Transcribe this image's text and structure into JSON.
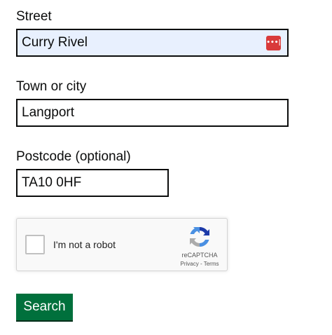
{
  "form": {
    "street": {
      "label": "Street",
      "value": "Curry Rivel",
      "autofilled": true
    },
    "town": {
      "label": "Town or city",
      "value": "Langport"
    },
    "postcode": {
      "label": "Postcode (optional)",
      "value": "TA10 0HF"
    },
    "password_manager_badge": {
      "icon": "password-manager-icon",
      "glyph": "•••|",
      "color": "#d93a3a"
    },
    "recaptcha": {
      "checkbox_label": "I'm not a robot",
      "brand": "reCAPTCHA",
      "privacy_link": "Privacy",
      "separator": " - ",
      "terms_link": "Terms",
      "logo_icon": "recaptcha-logo-icon"
    },
    "submit": {
      "label": "Search",
      "color": "#00703c"
    }
  }
}
